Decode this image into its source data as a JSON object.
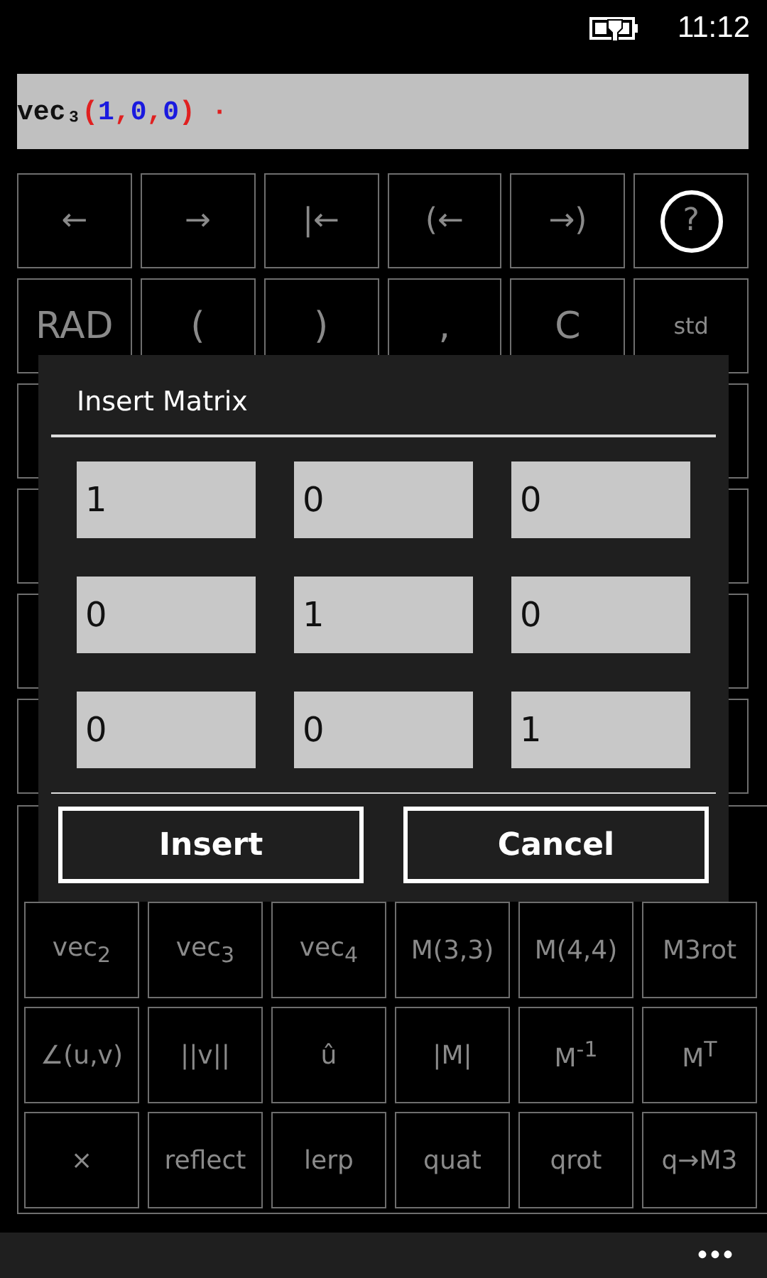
{
  "status_bar": {
    "time": "11:12"
  },
  "expression": [
    {
      "text": "vec₃",
      "color": "#111111"
    },
    {
      "text": "(",
      "color": "#e02020"
    },
    {
      "text": "1",
      "color": "#1a1adf"
    },
    {
      "text": ",",
      "color": "#e02020"
    },
    {
      "text": "0",
      "color": "#1a1adf"
    },
    {
      "text": ",",
      "color": "#e02020"
    },
    {
      "text": "0",
      "color": "#1a1adf"
    },
    {
      "text": ")",
      "color": "#e02020"
    },
    {
      "text": " ·",
      "color": "#e02020"
    }
  ],
  "keypad": [
    [
      {
        "kind": "key",
        "label": "←"
      },
      {
        "kind": "key",
        "label": "→"
      },
      {
        "kind": "key",
        "label": "|←"
      },
      {
        "kind": "key",
        "label": "(←"
      },
      {
        "kind": "key",
        "label": "→)"
      },
      {
        "kind": "help",
        "label": "?"
      }
    ],
    [
      {
        "kind": "big",
        "label": "RAD"
      },
      {
        "kind": "big",
        "label": "("
      },
      {
        "kind": "big",
        "label": ")"
      },
      {
        "kind": "big",
        "label": ","
      },
      {
        "kind": "big",
        "label": "C"
      },
      {
        "kind": "small",
        "label": "std"
      }
    ]
  ],
  "function_keys": [
    [
      "vec$_{2}$",
      "vec$_{3}$",
      "vec$_{4}$",
      "M(3,3)",
      "M(4,4)",
      "M3rot"
    ],
    [
      "∠(u,v)",
      "||v||",
      "û",
      "|M|",
      "M$^{-1}$",
      "M$^{T}$"
    ],
    [
      "×",
      "reflect",
      "lerp",
      "quat",
      "qrot",
      "q→M3"
    ]
  ],
  "dialog": {
    "title": "Insert Matrix",
    "matrix": [
      [
        "1",
        "0",
        "0"
      ],
      [
        "0",
        "1",
        "0"
      ],
      [
        "0",
        "0",
        "1"
      ]
    ],
    "buttons": [
      "Insert",
      "Cancel"
    ]
  },
  "app_bar": {
    "more": "•••"
  }
}
